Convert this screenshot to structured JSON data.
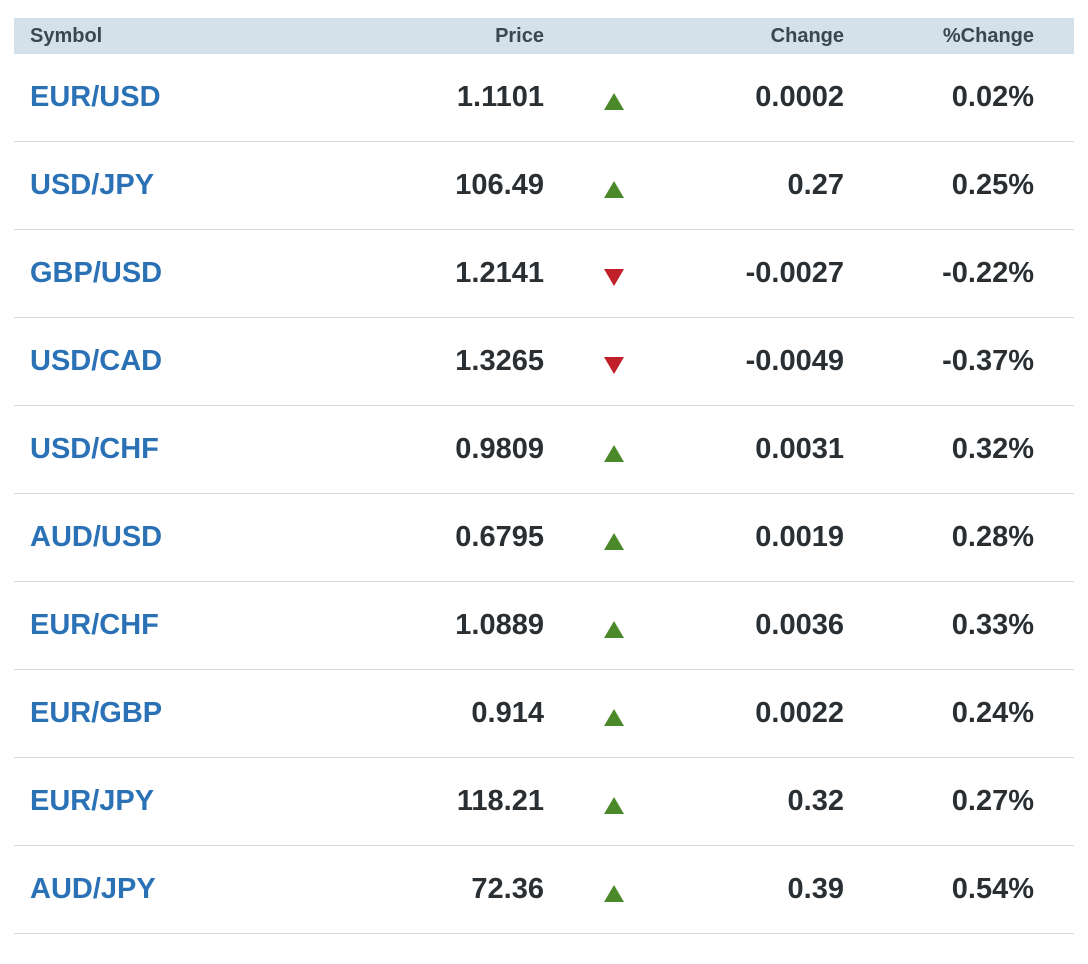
{
  "header": {
    "symbol": "Symbol",
    "price": "Price",
    "change": "Change",
    "pct_change": "%Change"
  },
  "colors": {
    "link": "#2a72b5",
    "up": "#4a8a2a",
    "down": "#c0202a",
    "header_bg": "#d5e1ea"
  },
  "rows": [
    {
      "symbol": "EUR/USD",
      "price": "1.1101",
      "direction": "up",
      "change": "0.0002",
      "pct_change": "0.02%"
    },
    {
      "symbol": "USD/JPY",
      "price": "106.49",
      "direction": "up",
      "change": "0.27",
      "pct_change": "0.25%"
    },
    {
      "symbol": "GBP/USD",
      "price": "1.2141",
      "direction": "down",
      "change": "-0.0027",
      "pct_change": "-0.22%"
    },
    {
      "symbol": "USD/CAD",
      "price": "1.3265",
      "direction": "down",
      "change": "-0.0049",
      "pct_change": "-0.37%"
    },
    {
      "symbol": "USD/CHF",
      "price": "0.9809",
      "direction": "up",
      "change": "0.0031",
      "pct_change": "0.32%"
    },
    {
      "symbol": "AUD/USD",
      "price": "0.6795",
      "direction": "up",
      "change": "0.0019",
      "pct_change": "0.28%"
    },
    {
      "symbol": "EUR/CHF",
      "price": "1.0889",
      "direction": "up",
      "change": "0.0036",
      "pct_change": "0.33%"
    },
    {
      "symbol": "EUR/GBP",
      "price": "0.914",
      "direction": "up",
      "change": "0.0022",
      "pct_change": "0.24%"
    },
    {
      "symbol": "EUR/JPY",
      "price": "118.21",
      "direction": "up",
      "change": "0.32",
      "pct_change": "0.27%"
    },
    {
      "symbol": "AUD/JPY",
      "price": "72.36",
      "direction": "up",
      "change": "0.39",
      "pct_change": "0.54%"
    }
  ]
}
